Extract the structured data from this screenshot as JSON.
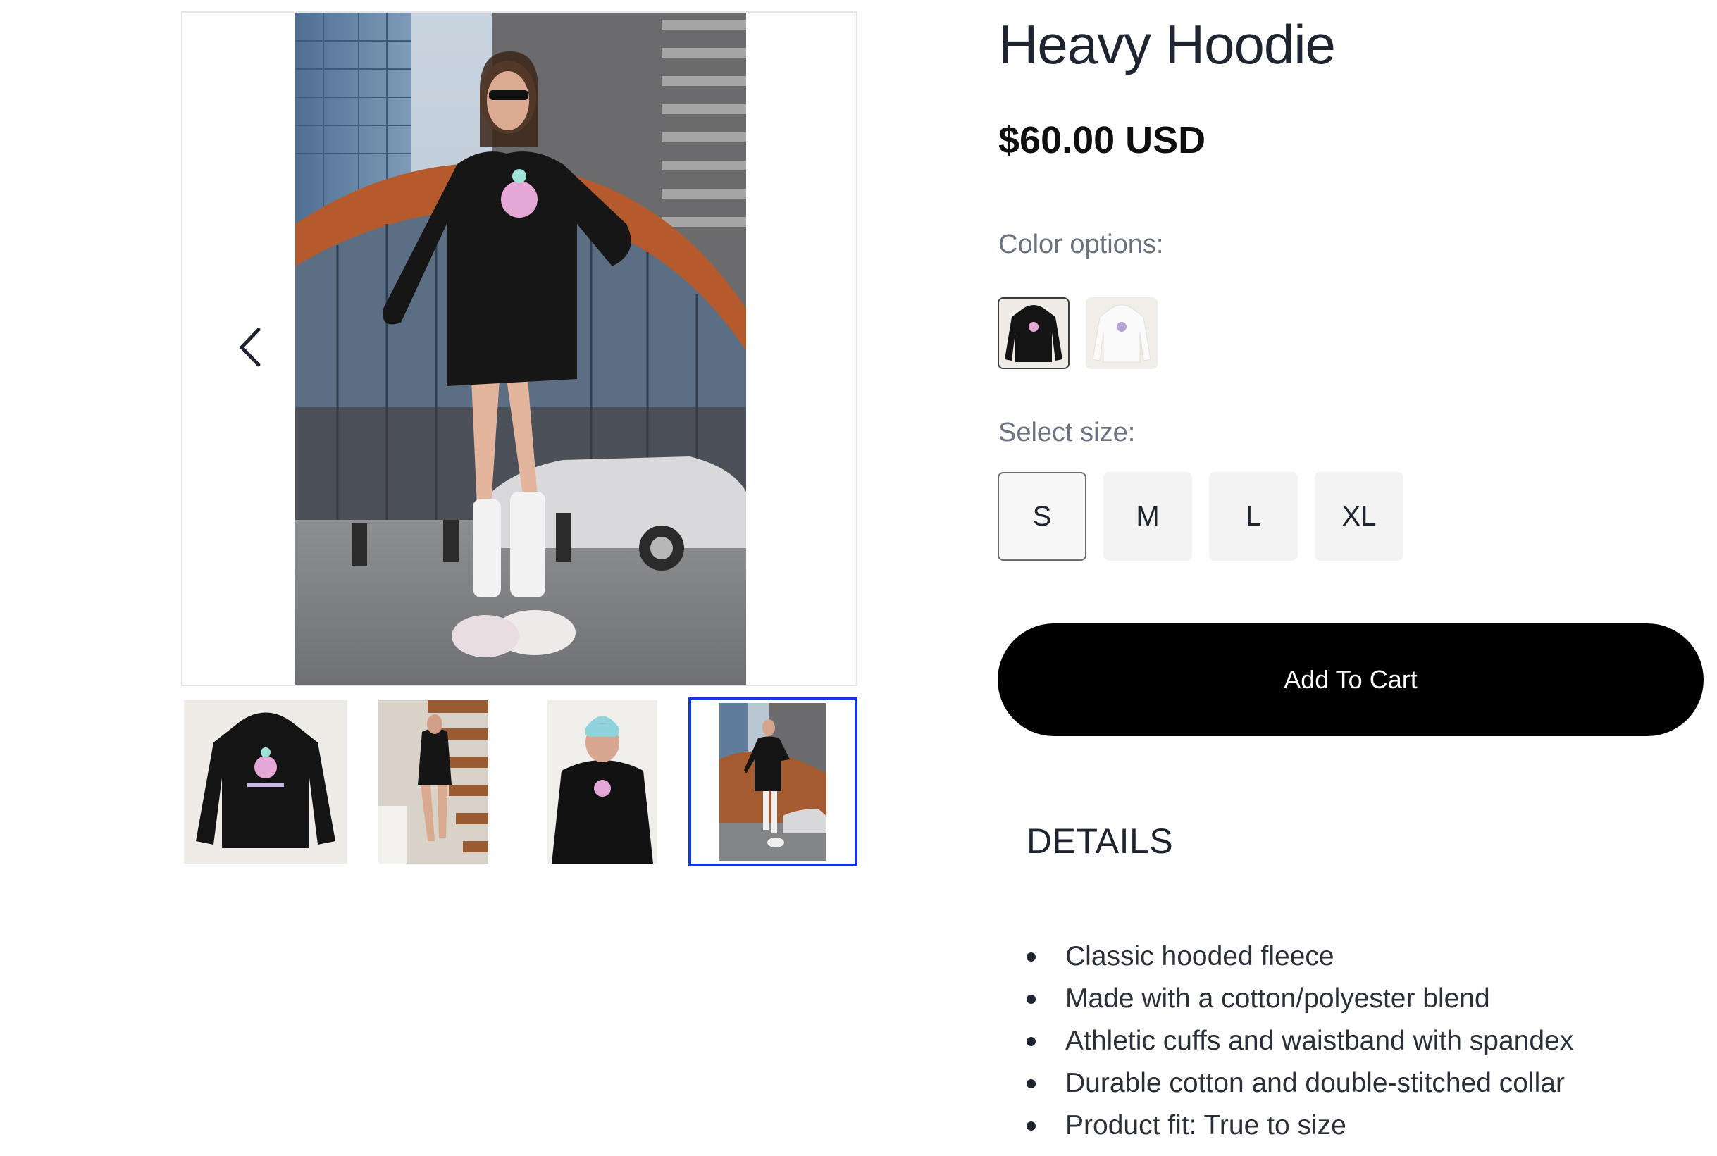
{
  "product": {
    "title": "Heavy Hoodie",
    "price": "$60.00 USD"
  },
  "gallery": {
    "prev_icon": "chevron-left-icon",
    "thumbnails": [
      {
        "name": "hoodie-front-flat",
        "active": false
      },
      {
        "name": "model-on-stairs",
        "active": false
      },
      {
        "name": "model-beanie",
        "active": false
      },
      {
        "name": "model-street",
        "active": true
      }
    ]
  },
  "color": {
    "label": "Color options:",
    "options": [
      {
        "name": "black-hoodie",
        "swatch": "#1c1c1c",
        "selected": true
      },
      {
        "name": "white-hoodie",
        "swatch": "#f4f4f4",
        "selected": false
      }
    ]
  },
  "size": {
    "label": "Select size:",
    "options": [
      "S",
      "M",
      "L",
      "XL"
    ],
    "selected": "S"
  },
  "cart": {
    "button_label": "Add To Cart"
  },
  "details": {
    "heading": "DETAILS",
    "items": [
      "Classic hooded fleece",
      "Made with a cotton/polyester blend",
      "Athletic cuffs and waistband with spandex",
      "Durable cotton and double-stitched collar",
      "Product fit: True to size"
    ]
  },
  "colors": {
    "accent_active_thumb": "#1336e6",
    "cart_button_bg": "#000000",
    "size_button_bg": "#f3f3f3"
  }
}
